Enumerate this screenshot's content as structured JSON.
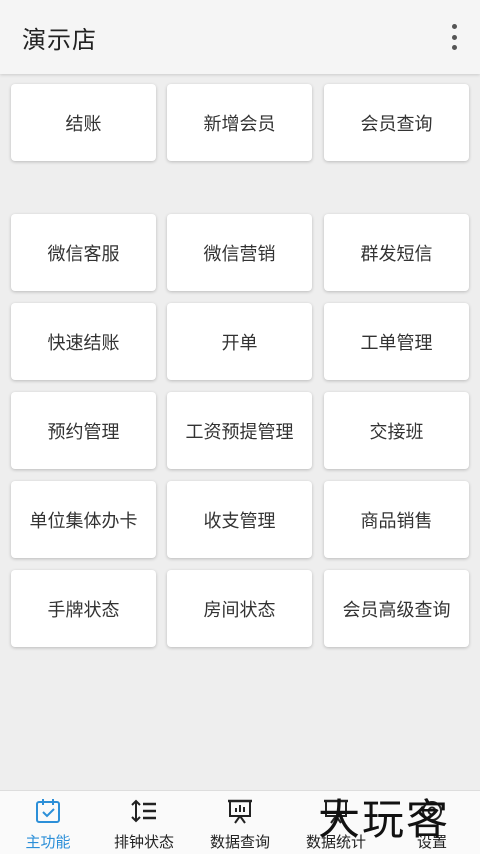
{
  "appbar": {
    "title": "演示店",
    "overflow_icon": "more-vertical-icon"
  },
  "top_row": [
    "结账",
    "新增会员",
    "会员查询"
  ],
  "grid": [
    [
      "微信客服",
      "微信营销",
      "群发短信"
    ],
    [
      "快速结账",
      "开单",
      "工单管理"
    ],
    [
      "预约管理",
      "工资预提管理",
      "交接班"
    ],
    [
      "单位集体办卡",
      "收支管理",
      "商品销售"
    ],
    [
      "手牌状态",
      "房间状态",
      "会员高级查询"
    ]
  ],
  "nav": [
    {
      "label": "主功能",
      "icon": "calendar-check-icon",
      "active": true
    },
    {
      "label": "排钟状态",
      "icon": "sort-list-icon",
      "active": false
    },
    {
      "label": "数据查询",
      "icon": "presentation-chart-icon",
      "active": false
    },
    {
      "label": "数据统计",
      "icon": "board-icon",
      "active": false
    },
    {
      "label": "设置",
      "icon": "settings-icon",
      "active": false
    }
  ],
  "watermark": "大玩客",
  "colors": {
    "accent": "#2c8fd8",
    "background": "#eeeeee",
    "tile": "#ffffff"
  }
}
